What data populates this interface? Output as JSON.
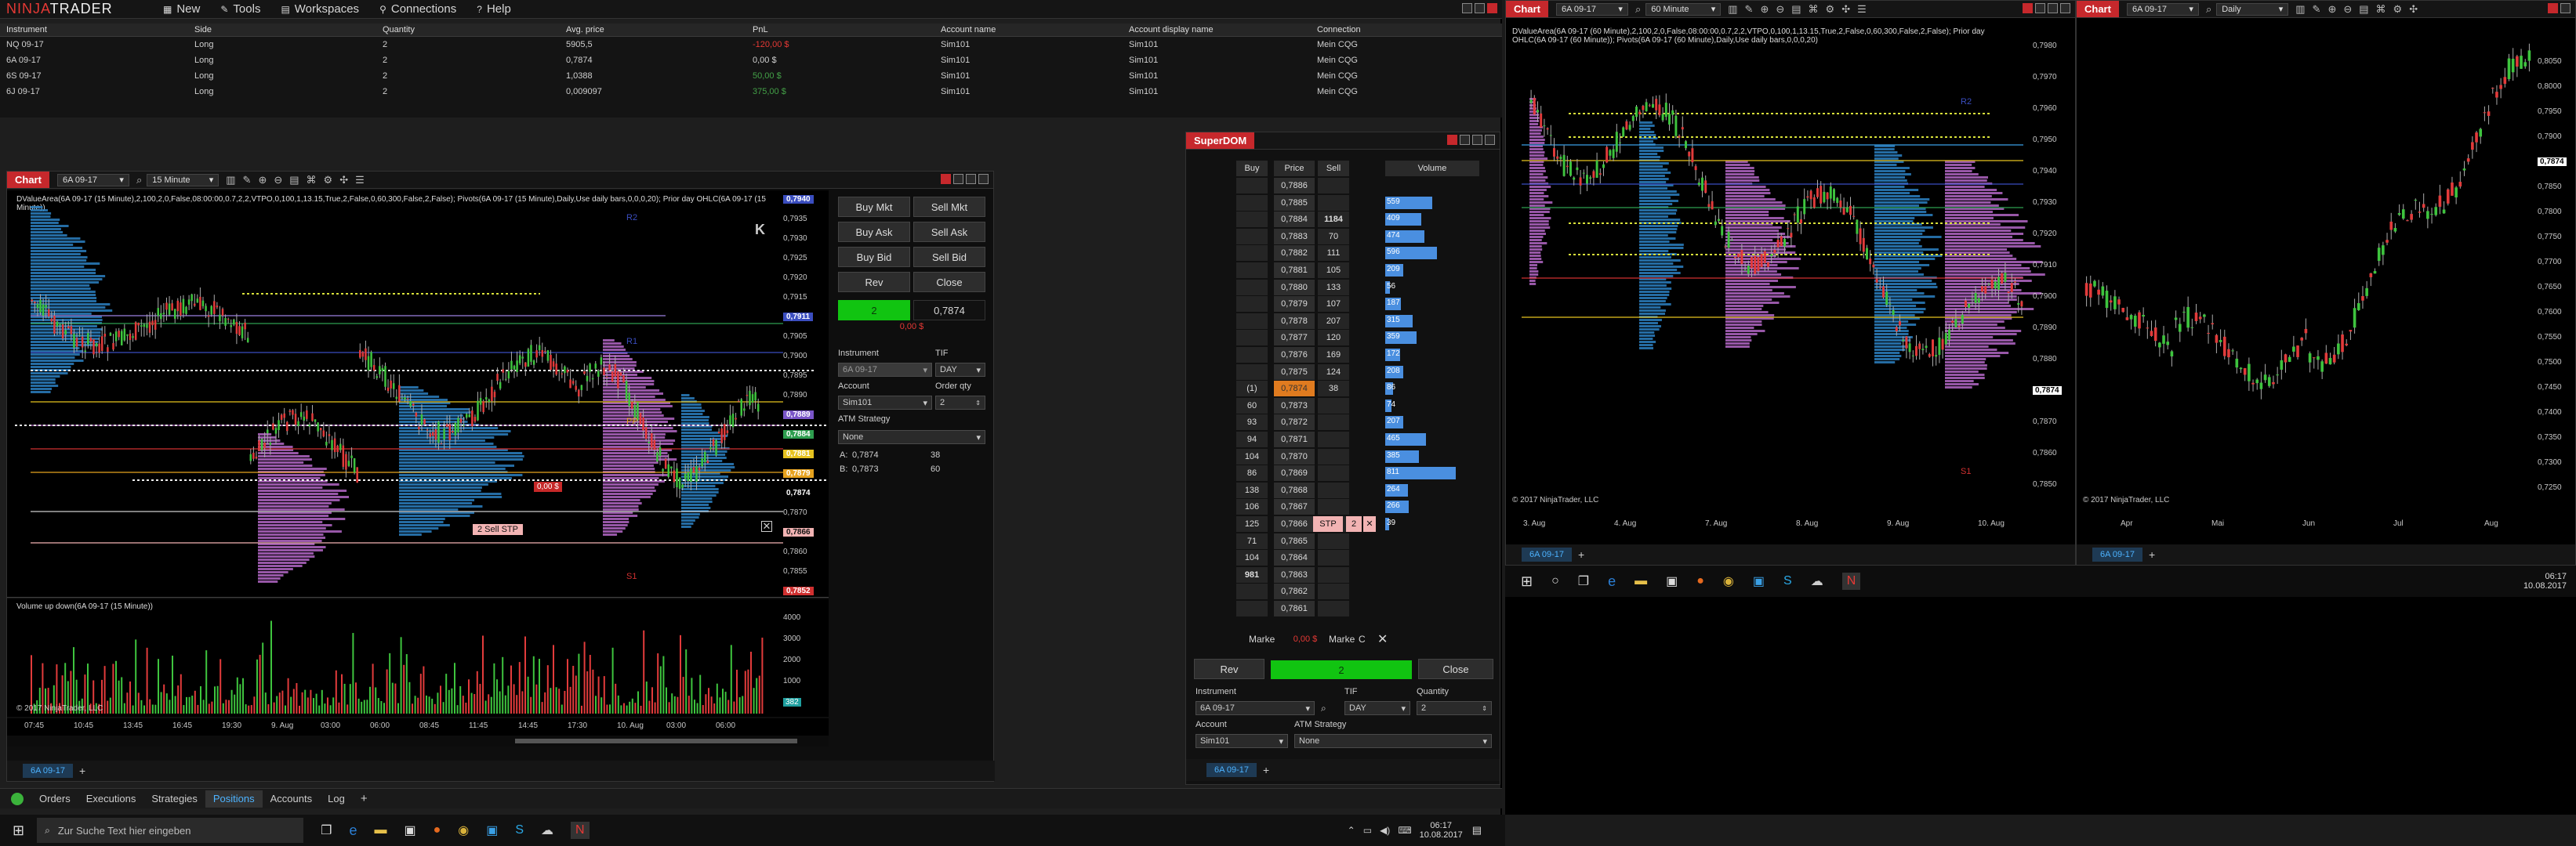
{
  "menu": {
    "logo_red": "NINJA",
    "logo_white": "TRADER",
    "items": [
      "New",
      "Tools",
      "Workspaces",
      "Connections",
      "Help"
    ]
  },
  "positions": {
    "columns": [
      "Instrument",
      "Side",
      "Quantity",
      "Avg. price",
      "PnL",
      "Account name",
      "Account display name",
      "Connection"
    ],
    "rows": [
      [
        "NQ 09-17",
        "Long",
        "2",
        "5905,5",
        "-120,00 $",
        "Sim101",
        "Sim101",
        "Mein CQG"
      ],
      [
        "6A 09-17",
        "Long",
        "2",
        "0,7874",
        "0,00 $",
        "Sim101",
        "Sim101",
        "Mein CQG"
      ],
      [
        "6S 09-17",
        "Long",
        "2",
        "1,0388",
        "50,00 $",
        "Sim101",
        "Sim101",
        "Mein CQG"
      ],
      [
        "6J 09-17",
        "Long",
        "2",
        "0,009097",
        "375,00 $",
        "Sim101",
        "Sim101",
        "Mein CQG"
      ]
    ],
    "pnl_colors": [
      "#e53935",
      "#d0d0d0",
      "#43a047",
      "#43a047"
    ]
  },
  "chart1": {
    "tab": "Chart",
    "instrument": "6A 09-17",
    "interval": "15 Minute",
    "indicator_text": "DValueArea(6A 09-17 (15 Minute),2,100,2,0,False,08:00:00,0.7,2,2,VTPO,0,100,1,13.15,True,2,False,0,60,300,False,2,False); Pivots(6A 09-17 (15 Minute),Daily,Use daily bars,0,0,0,20); Prior day OHLC(6A 09-17 (15 Minute))",
    "price_labels": [
      "0,7940",
      "0,7935",
      "0,7930",
      "0,7925",
      "0,7920",
      "0,7915",
      "0,7911",
      "0,7905",
      "0,7900",
      "0,7895",
      "0,7890",
      "0,7889",
      "0,7884",
      "0,7881",
      "0,7879",
      "0,7874",
      "0,7870",
      "0,7866",
      "0,7860",
      "0,7855",
      "0,7852"
    ],
    "tagged": {
      "0,7940": "#3a4dbf",
      "0,7911": "#3a4dbf",
      "0,7889": "#7a55c8",
      "0,7884": "#2e9e4f",
      "0,7881": "#e6c21f",
      "0,7879": "#e6a21f",
      "0,7874": "#000000",
      "0,7866": "#f2b3b3",
      "0,7852": "#d03030"
    },
    "time_labels": [
      "07:45",
      "10:45",
      "13:45",
      "16:45",
      "19:30",
      "9. Aug",
      "03:00",
      "06:00",
      "08:45",
      "11:45",
      "14:45",
      "17:30",
      "10. Aug",
      "03:00",
      "06:00"
    ],
    "order_label": "2  Sell STP",
    "pos_label": "0,00 $",
    "pivot_labels": [
      "R2",
      "R1",
      "PP",
      "S1"
    ],
    "copyright": "© 2017 NinjaTrader, LLC",
    "volume_title": "Volume up down(6A 09-17 (15 Minute))",
    "volume_axis": [
      "4000",
      "3000",
      "2000",
      "1000",
      "382"
    ],
    "bottom_tab": "6A 09-17"
  },
  "chart_trader": {
    "buy_mkt": "Buy Mkt",
    "sell_mkt": "Sell Mkt",
    "buy_ask": "Buy Ask",
    "sell_ask": "Sell Ask",
    "buy_bid": "Buy Bid",
    "sell_bid": "Sell Bid",
    "rev": "Rev",
    "close": "Close",
    "position_qty": "2",
    "position_price": "0,7874",
    "pnl": "0,00 $",
    "instrument_label": "Instrument",
    "instrument": "6A 09-17",
    "tif_label": "TIF",
    "tif": "DAY",
    "account_label": "Account",
    "account": "Sim101",
    "qty_label": "Order qty",
    "qty": "2",
    "atm_label": "ATM Strategy",
    "atm": "None",
    "ask_label": "A:",
    "ask_price": "0,7874",
    "ask_size": "38",
    "bid_label": "B:",
    "bid_price": "0,7873",
    "bid_size": "60"
  },
  "superdom": {
    "title": "SuperDOM",
    "headers": [
      "Buy",
      "Price",
      "Sell",
      "Volume"
    ],
    "rows": [
      {
        "buy": "",
        "price": "0,7886",
        "sell": "",
        "vol": ""
      },
      {
        "buy": "",
        "price": "0,7885",
        "sell": "",
        "vol": "559"
      },
      {
        "buy": "",
        "price": "0,7884",
        "sell": "1184",
        "vol": "409"
      },
      {
        "buy": "",
        "price": "0,7883",
        "sell": "70",
        "vol": "474"
      },
      {
        "buy": "",
        "price": "0,7882",
        "sell": "111",
        "vol": "596"
      },
      {
        "buy": "",
        "price": "0,7881",
        "sell": "105",
        "vol": "209"
      },
      {
        "buy": "",
        "price": "0,7880",
        "sell": "133",
        "vol": "56"
      },
      {
        "buy": "",
        "price": "0,7879",
        "sell": "107",
        "vol": "187"
      },
      {
        "buy": "",
        "price": "0,7878",
        "sell": "207",
        "vol": "315"
      },
      {
        "buy": "",
        "price": "0,7877",
        "sell": "120",
        "vol": "359"
      },
      {
        "buy": "",
        "price": "0,7876",
        "sell": "169",
        "vol": "172"
      },
      {
        "buy": "",
        "price": "0,7875",
        "sell": "124",
        "vol": "208"
      },
      {
        "buy": "(1)",
        "price": "0,7874",
        "sell": "38",
        "vol": "86"
      },
      {
        "buy": "60",
        "price": "0,7873",
        "sell": "",
        "vol": "74"
      },
      {
        "buy": "93",
        "price": "0,7872",
        "sell": "",
        "vol": "207"
      },
      {
        "buy": "94",
        "price": "0,7871",
        "sell": "",
        "vol": "465"
      },
      {
        "buy": "104",
        "price": "0,7870",
        "sell": "",
        "vol": "385"
      },
      {
        "buy": "86",
        "price": "0,7869",
        "sell": "",
        "vol": "811"
      },
      {
        "buy": "138",
        "price": "0,7868",
        "sell": "",
        "vol": "264"
      },
      {
        "buy": "106",
        "price": "0,7867",
        "sell": "",
        "vol": "266"
      },
      {
        "buy": "125",
        "price": "0,7866",
        "sell": "",
        "vol": "39"
      },
      {
        "buy": "71",
        "price": "0,7865",
        "sell": "",
        "vol": ""
      },
      {
        "buy": "104",
        "price": "0,7864",
        "sell": "",
        "vol": ""
      },
      {
        "buy": "981",
        "price": "0,7863",
        "sell": "",
        "vol": ""
      },
      {
        "buy": "",
        "price": "0,7862",
        "sell": "",
        "vol": ""
      },
      {
        "buy": "",
        "price": "0,7861",
        "sell": "",
        "vol": ""
      }
    ],
    "vol_bars": [
      0,
      0.5,
      0.38,
      0.42,
      0.55,
      0.19,
      0.05,
      0.17,
      0.29,
      0.33,
      0.16,
      0.19,
      0.08,
      0.07,
      0.19,
      0.43,
      0.36,
      0.75,
      0.24,
      0.25,
      0.04,
      0,
      0,
      0,
      0,
      0
    ],
    "stop_label": "STP",
    "stop_qty": "2",
    "market_buy": "Marke",
    "market_pnl": "0,00 $",
    "market_sell": "Marke",
    "c_label": "C",
    "rev": "Rev",
    "qty_display": "2",
    "close": "Close",
    "instrument_label": "Instrument",
    "instrument": "6A 09-17",
    "tif_label": "TIF",
    "tif": "DAY",
    "qty_label": "Quantity",
    "qty": "2",
    "account_label": "Account",
    "account": "Sim101",
    "atm_label": "ATM Strategy",
    "atm": "None",
    "bottom_tab": "6A 09-17"
  },
  "control_tabs": [
    "Orders",
    "Executions",
    "Strategies",
    "Positions",
    "Accounts",
    "Log"
  ],
  "chart2": {
    "tab": "Chart",
    "instrument": "6A 09-17",
    "interval": "60 Minute",
    "indicator_text": "DValueArea(6A 09-17 (60 Minute),2,100,2,0,False,08:00:00,0.7,2,2,VTPO,0,100,1,13.15,True,2,False,0,60,300,False,2,False); Prior day OHLC(6A 09-17 (60 Minute)); Pivots(6A 09-17 (60 Minute),Daily,Use daily bars,0,0,0,20)",
    "price_labels": [
      "0,7980",
      "0,7970",
      "0,7960",
      "0,7950",
      "0,7940",
      "0,7930",
      "0,7920",
      "0,7910",
      "0,7900",
      "0,7890",
      "0,7880",
      "0,7874",
      "0,7870",
      "0,7860",
      "0,7850"
    ],
    "time_labels": [
      "3. Aug",
      "4. Aug",
      "7. Aug",
      "8. Aug",
      "9. Aug",
      "10. Aug"
    ],
    "pivot_labels": [
      "R2",
      "S1"
    ],
    "copyright": "© 2017 NinjaTrader, LLC",
    "bottom_tab": "6A 09-17"
  },
  "chart3": {
    "tab": "Chart",
    "instrument": "6A 09-17",
    "interval": "Daily",
    "price_labels": [
      "0,8050",
      "0,8000",
      "0,7950",
      "0,7900",
      "0,7874",
      "0,7850",
      "0,7800",
      "0,7750",
      "0,7700",
      "0,7650",
      "0,7600",
      "0,7550",
      "0,7500",
      "0,7450",
      "0,7400",
      "0,7350",
      "0,7300",
      "0,7250"
    ],
    "time_labels": [
      "Apr",
      "Mai",
      "Jun",
      "Jul",
      "Aug"
    ],
    "copyright": "© 2017 NinjaTrader, LLC",
    "bottom_tab": "6A 09-17"
  },
  "taskbar": {
    "search_placeholder": "Zur Suche Text hier eingeben",
    "time": "06:17",
    "date": "10.08.2017",
    "notif": "8"
  }
}
